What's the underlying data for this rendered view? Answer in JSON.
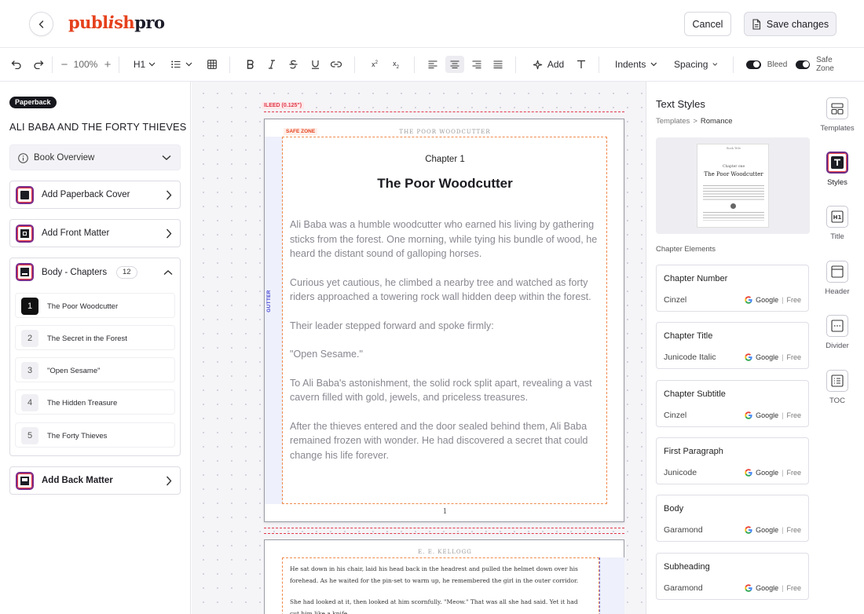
{
  "header": {
    "logo_part1": "publ",
    "logo_part2": "i",
    "logo_part3": "sh",
    "logo_part4": "pro",
    "cancel_label": "Cancel",
    "save_label": "Save changes"
  },
  "toolbar": {
    "zoom": "100%",
    "heading": "H1",
    "add_label": "Add",
    "indents_label": "Indents",
    "spacing_label": "Spacing",
    "bleed_label": "Bleed",
    "safe_zone_label": "Safe Zone"
  },
  "sidebar": {
    "badge": "Paperback",
    "book_title": "ALI BABA AND THE FORTY THIEVES",
    "overview_label": "Book Overview",
    "cover_label": "Add Paperback Cover",
    "front_matter_label": "Add Front Matter",
    "body_label": "Body - Chapters",
    "chapter_count": "12",
    "back_matter_label": "Add Back Matter",
    "chapters": [
      {
        "num": "1",
        "title": "The Poor Woodcutter"
      },
      {
        "num": "2",
        "title": "The Secret in the Forest"
      },
      {
        "num": "3",
        "title": "\"Open Sesame\""
      },
      {
        "num": "4",
        "title": "The Hidden Treasure"
      },
      {
        "num": "5",
        "title": "The Forty Thieves"
      }
    ]
  },
  "editor": {
    "bleed_tag": "ILEED (0.125\")",
    "running_head": "THE POOR WOODCUTTER",
    "safe_zone_tag": "SAFE ZONE",
    "gutter_tag": "GUTTER",
    "chapter_label": "Chapter 1",
    "chapter_title": "The Poor Woodcutter",
    "paragraphs": [
      "Ali Baba was a humble woodcutter who earned his living by gathering sticks from the forest. One morning, while tying his bundle of wood, he heard the distant sound of galloping horses.",
      "Curious yet cautious, he climbed a nearby tree and watched as forty riders approached a towering rock wall hidden deep within the forest.",
      "Their leader stepped forward and spoke firmly:",
      "\"Open Sesame.\"",
      "To Ali Baba's astonishment, the solid rock split apart, revealing a vast cavern filled with gold, jewels, and priceless treasures.",
      "After the thieves entered and the door sealed behind them, Ali Baba remained frozen with wonder. He had discovered a secret that could change his life forever."
    ],
    "page_number": "1",
    "page2_head": "E. E. KELLOGG",
    "page2_p1": "He sat down in his chair, laid his head back in the headrest and pulled the helmet down over his forehead. As he waited for the pin-set to warm up, he remembered the girl in the outer corridor.",
    "page2_p2": "She had looked at it, then looked at him scornfully. \"Meow.\" That was all she had said. Yet it had cut him like a knife."
  },
  "styles_panel": {
    "title": "Text Styles",
    "breadcrumb_root": "Templates",
    "breadcrumb_sep": ">",
    "breadcrumb_leaf": "Romance",
    "preview_head": "Book Title",
    "preview_chapter": "Chapter one",
    "preview_title": "The Poor Woodcutter",
    "section_label": "Chapter Elements",
    "elements": [
      {
        "name": "Chapter Number",
        "font": "Cinzel",
        "source": "Google",
        "price": "Free"
      },
      {
        "name": "Chapter Title",
        "font": "Junicode Italic",
        "source": "Google",
        "price": "Free"
      },
      {
        "name": "Chapter Subtitle",
        "font": "Cinzel",
        "source": "Google",
        "price": "Free"
      },
      {
        "name": "First Paragraph",
        "font": "Junicode",
        "source": "Google",
        "price": "Free"
      },
      {
        "name": "Body",
        "font": "Garamond",
        "source": "Google",
        "price": "Free"
      },
      {
        "name": "Subheading",
        "font": "Garamond",
        "source": "Google",
        "price": "Free"
      }
    ]
  },
  "rail": {
    "items": [
      {
        "label": "Templates"
      },
      {
        "label": "Styles"
      },
      {
        "label": "Title"
      },
      {
        "label": "Header"
      },
      {
        "label": "Divider"
      },
      {
        "label": "TOC"
      }
    ]
  },
  "colors": {
    "brand": "#e5401c",
    "bleed_line": "#e0384a",
    "safe_zone_line": "#f08a4b",
    "gutter_line": "#6b6bf0"
  }
}
